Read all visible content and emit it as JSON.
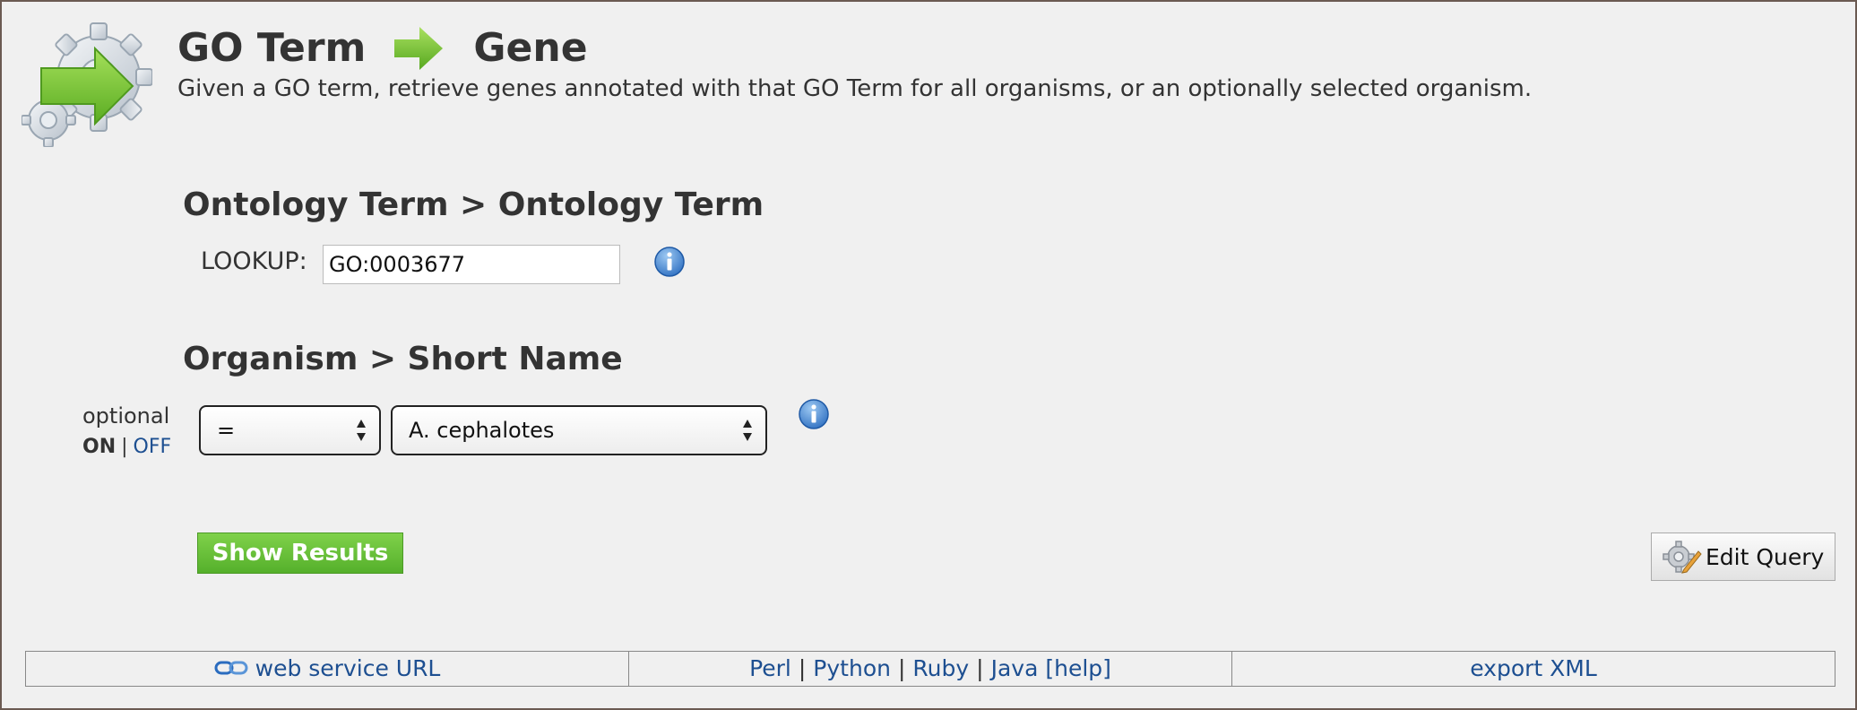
{
  "header": {
    "title_from": "GO Term",
    "title_to": "Gene",
    "description": "Given a GO term, retrieve genes annotated with that GO Term for all organisms, or an optionally selected organism.",
    "logo_icon": "gear-arrow-icon",
    "arrow_icon": "arrow-right-icon"
  },
  "constraint1": {
    "heading": "Ontology Term > Ontology Term",
    "lookup_label": "LOOKUP:",
    "lookup_value": "GO:0003677",
    "info_icon": "info-icon"
  },
  "constraint2": {
    "heading": "Organism > Short Name",
    "optional_label": "optional",
    "toggle_on": "ON",
    "toggle_separator": "|",
    "toggle_off": "OFF",
    "operator_value": "=",
    "organism_value": "A. cephalotes",
    "info_icon": "info-icon"
  },
  "actions": {
    "show_results_label": "Show Results",
    "edit_query_label": "Edit Query"
  },
  "footer": {
    "web_service_label": "web service URL",
    "languages": [
      "Perl",
      "Python",
      "Ruby",
      "Java [help]"
    ],
    "separator": "|",
    "export_label": "export XML"
  },
  "colors": {
    "background": "#f0f0f0",
    "link": "#1d4f91",
    "accent_green": "#5cb82e",
    "info_blue": "#3a7bc8",
    "frame_border": "#6b5a52"
  }
}
